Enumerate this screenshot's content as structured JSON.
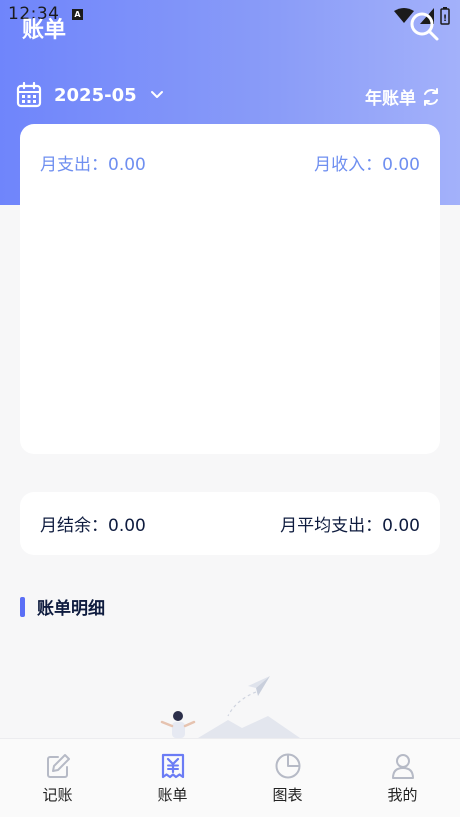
{
  "status_bar": {
    "time": "12:34",
    "badge": "A"
  },
  "header": {
    "title": "账单",
    "date": "2025-05",
    "year_bill_label": "年账单"
  },
  "summary": {
    "expense_label": "月支出：0.00",
    "income_label": "月收入：0.00"
  },
  "balance": {
    "balance_label": "月结余：0.00",
    "avg_expense_label": "月平均支出：0.00"
  },
  "details": {
    "title": "账单明细"
  },
  "tabs": [
    {
      "label": "记账",
      "icon": "edit-icon"
    },
    {
      "label": "账单",
      "icon": "bill-icon"
    },
    {
      "label": "图表",
      "icon": "pie-chart-icon"
    },
    {
      "label": "我的",
      "icon": "user-icon"
    }
  ],
  "colors": {
    "header_gradient_start": "#6f85fb",
    "header_gradient_end": "#a3b1fa",
    "accent": "#6f8ff0",
    "text_dark": "#0f1c3f",
    "tab_active": "#6b7cf5"
  }
}
